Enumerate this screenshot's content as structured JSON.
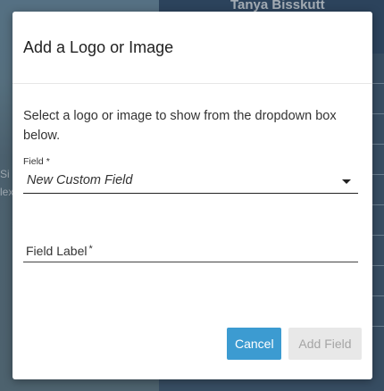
{
  "background": {
    "user_name": "Tanya Bisskutt",
    "left_partial_1": "Si",
    "left_partial_2": "lex"
  },
  "dialog": {
    "title": "Add a Logo or Image",
    "description": "Select a logo or image to show from the dropdown box below.",
    "field": {
      "label": "Field",
      "required_mark": "*",
      "value": "New Custom Field"
    },
    "field_label_input": {
      "label": "Field Label",
      "required_mark": "*",
      "value": ""
    },
    "buttons": {
      "cancel": "Cancel",
      "add_field": "Add Field"
    }
  },
  "colors": {
    "primary": "#3c9bd1",
    "disabled_bg": "#e8e8e8",
    "disabled_text": "#a5a5a5"
  }
}
